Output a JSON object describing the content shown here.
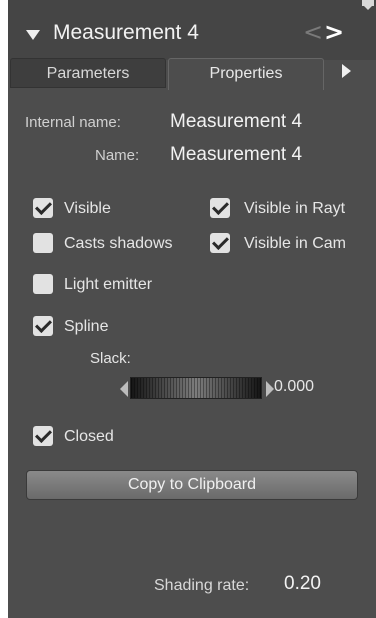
{
  "header": {
    "title": "Measurement 4",
    "prev_glyph": "<",
    "next_glyph": ">"
  },
  "tabs": [
    {
      "label": "Parameters",
      "active": false
    },
    {
      "label": "Properties",
      "active": true
    }
  ],
  "info": {
    "internal_name_label": "Internal name:",
    "internal_name_value": "Measurement 4",
    "name_label": "Name:",
    "name_value": "Measurement 4"
  },
  "checkboxes": {
    "visible": {
      "label": "Visible",
      "checked": true
    },
    "visible_in_raytrace": {
      "label": "Visible in Rayt",
      "checked": true
    },
    "casts_shadows": {
      "label": "Casts shadows",
      "checked": false
    },
    "visible_in_camera": {
      "label": "Visible in Cam",
      "checked": true
    },
    "light_emitter": {
      "label": "Light emitter",
      "checked": false
    },
    "spline": {
      "label": "Spline",
      "checked": true
    },
    "closed": {
      "label": "Closed",
      "checked": true
    }
  },
  "slack": {
    "label": "Slack:",
    "value": "0.000"
  },
  "copy_button_label": "Copy to Clipboard",
  "shading": {
    "label": "Shading rate:",
    "value": "0.20"
  },
  "colors": {
    "panel_bg": "#4d4d4d",
    "checkbox_bg": "#e2e2e2",
    "button_bg": "#7a7a7a"
  }
}
